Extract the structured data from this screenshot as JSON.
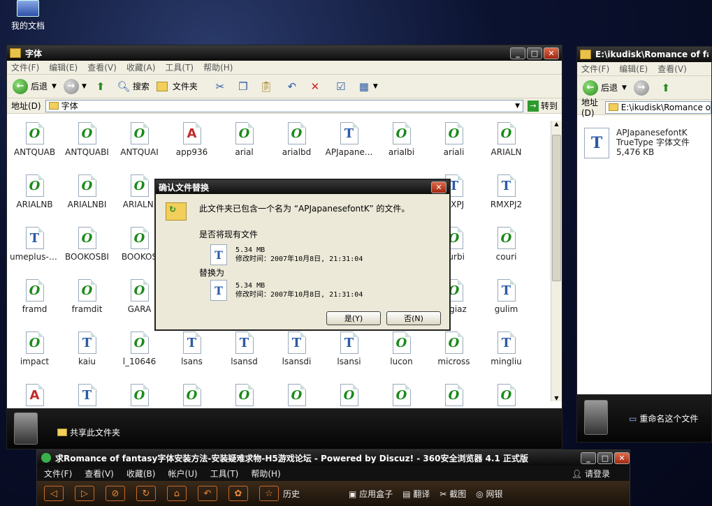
{
  "desktop": {
    "icon_label": "我的文档"
  },
  "explorer": {
    "title": "字体",
    "menu": [
      "文件(F)",
      "编辑(E)",
      "查看(V)",
      "收藏(A)",
      "工具(T)",
      "帮助(H)"
    ],
    "toolbar": {
      "back": "后退",
      "search": "搜索",
      "folders": "文件夹"
    },
    "address_label": "地址(D)",
    "address_value": "字体",
    "go_label": "转到",
    "share_label": "共享此文件夹",
    "files": [
      {
        "name": "ANTQUAB",
        "type": "o"
      },
      {
        "name": "ANTQUABI",
        "type": "o"
      },
      {
        "name": "ANTQUAI",
        "type": "o"
      },
      {
        "name": "app936",
        "type": "a"
      },
      {
        "name": "arial",
        "type": "o"
      },
      {
        "name": "arialbd",
        "type": "o"
      },
      {
        "name": "APJapane...",
        "type": "tt"
      },
      {
        "name": "arialbi",
        "type": "o"
      },
      {
        "name": "ariali",
        "type": "o"
      },
      {
        "name": "ARIALN",
        "type": "o"
      },
      {
        "name": "ARIALNB",
        "type": "o"
      },
      {
        "name": "ARIALNBI",
        "type": "o"
      },
      {
        "name": "ARIALNI",
        "type": "o"
      },
      {
        "name": "",
        "type": "none"
      },
      {
        "name": "",
        "type": "none"
      },
      {
        "name": "",
        "type": "none"
      },
      {
        "name": "",
        "type": "none"
      },
      {
        "name": "",
        "type": "none"
      },
      {
        "name": "MXPJ",
        "type": "tt"
      },
      {
        "name": "RMXPJ2",
        "type": "tt"
      },
      {
        "name": "umeplus-g...",
        "type": "tt"
      },
      {
        "name": "BOOKOSBI",
        "type": "o"
      },
      {
        "name": "BOOKOS",
        "type": "o"
      },
      {
        "name": "",
        "type": "none"
      },
      {
        "name": "",
        "type": "none"
      },
      {
        "name": "",
        "type": "none"
      },
      {
        "name": "",
        "type": "none"
      },
      {
        "name": "",
        "type": "none"
      },
      {
        "name": "ourbi",
        "type": "o"
      },
      {
        "name": "couri",
        "type": "o"
      },
      {
        "name": "framd",
        "type": "o"
      },
      {
        "name": "framdit",
        "type": "o"
      },
      {
        "name": "GARA",
        "type": "o"
      },
      {
        "name": "",
        "type": "none"
      },
      {
        "name": "",
        "type": "none"
      },
      {
        "name": "",
        "type": "none"
      },
      {
        "name": "",
        "type": "none"
      },
      {
        "name": "",
        "type": "none"
      },
      {
        "name": "orgiaz",
        "type": "o"
      },
      {
        "name": "gulim",
        "type": "tt"
      },
      {
        "name": "impact",
        "type": "o"
      },
      {
        "name": "kaiu",
        "type": "tt"
      },
      {
        "name": "l_10646",
        "type": "o"
      },
      {
        "name": "lsans",
        "type": "tt"
      },
      {
        "name": "lsansd",
        "type": "tt"
      },
      {
        "name": "lsansdi",
        "type": "tt"
      },
      {
        "name": "lsansi",
        "type": "tt"
      },
      {
        "name": "lucon",
        "type": "o"
      },
      {
        "name": "micross",
        "type": "o"
      },
      {
        "name": "mingliu",
        "type": "tt"
      },
      {
        "name": "",
        "type": "a"
      },
      {
        "name": "",
        "type": "tt"
      },
      {
        "name": "",
        "type": "o"
      },
      {
        "name": "",
        "type": "o"
      },
      {
        "name": "",
        "type": "o"
      },
      {
        "name": "",
        "type": "o"
      },
      {
        "name": "",
        "type": "o"
      },
      {
        "name": "",
        "type": "o"
      },
      {
        "name": "",
        "type": "o"
      },
      {
        "name": "",
        "type": "o"
      }
    ]
  },
  "right_window": {
    "title": "E:\\ikudisk\\Romance of fanta",
    "menu": [
      "文件(F)",
      "编辑(E)",
      "查看(V)"
    ],
    "back": "后退",
    "address_label": "地址(D)",
    "address_value": "E:\\ikudisk\\Romance o",
    "file_name": "APJapanesefontK",
    "file_type": "TrueType 字体文件",
    "file_size": "5,476 KB",
    "rename_label": "重命名这个文件"
  },
  "dialog": {
    "title": "确认文件替换",
    "message": "此文件夹已包含一个名为 “APJapanesefontK” 的文件。",
    "replace_question": "是否将现有文件",
    "existing_size": "5.34 MB",
    "existing_time": "修改时间：2007年10月8日, 21:31:04",
    "replace_with": "替换为",
    "new_size": "5.34 MB",
    "new_time": "修改时间：2007年10月8日, 21:31:04",
    "yes": "是(Y)",
    "no": "否(N)"
  },
  "browser": {
    "title": "求Romance of fantasy字体安装方法-安装疑难求物-H5游戏论坛 - Powered by Discuz! - 360安全浏览器 4.1 正式版",
    "menu": [
      "文件(F)",
      "查看(V)",
      "收藏(B)",
      "帐户(U)",
      "工具(T)",
      "帮助(H)"
    ],
    "login": "请登录",
    "history": "历史",
    "app_box": "应用盒子",
    "translate": "翻译",
    "screenshot": "截图",
    "netbank": "网银"
  },
  "colors": {
    "title_bg": "#0d0d0d",
    "xp_beige": "#f1efe2",
    "dialog_bg": "#ece9d8"
  }
}
